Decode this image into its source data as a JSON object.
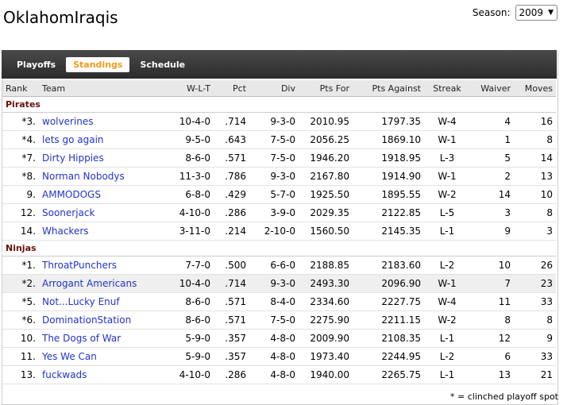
{
  "page_title": "OklahomIraqis",
  "season": {
    "label": "Season:",
    "value": "2009"
  },
  "tabs": [
    {
      "label": "Playoffs",
      "active": false
    },
    {
      "label": "Standings",
      "active": true
    },
    {
      "label": "Schedule",
      "active": false
    }
  ],
  "columns": [
    "Rank",
    "Team",
    "W-L-T",
    "Pct",
    "Div",
    "Pts For",
    "Pts Against",
    "Streak",
    "Waiver",
    "Moves"
  ],
  "divisions": [
    {
      "name": "Pirates",
      "teams": [
        {
          "rank": "*3.",
          "team": "wolverines",
          "wlt": "10-4-0",
          "pct": ".714",
          "div": "9-3-0",
          "pts_for": "2010.95",
          "pts_against": "1797.35",
          "streak": "W-4",
          "waiver": "4",
          "moves": "16"
        },
        {
          "rank": "*4.",
          "team": "lets go again",
          "wlt": "9-5-0",
          "pct": ".643",
          "div": "7-5-0",
          "pts_for": "2056.25",
          "pts_against": "1869.10",
          "streak": "W-1",
          "waiver": "1",
          "moves": "8"
        },
        {
          "rank": "*7.",
          "team": "Dirty Hippies",
          "wlt": "8-6-0",
          "pct": ".571",
          "div": "7-5-0",
          "pts_for": "1946.20",
          "pts_against": "1918.95",
          "streak": "L-3",
          "waiver": "5",
          "moves": "14"
        },
        {
          "rank": "*8.",
          "team": "Norman Nobodys",
          "wlt": "11-3-0",
          "pct": ".786",
          "div": "9-3-0",
          "pts_for": "2167.80",
          "pts_against": "1914.90",
          "streak": "W-1",
          "waiver": "2",
          "moves": "13"
        },
        {
          "rank": "9.",
          "team": "AMMODOGS",
          "wlt": "6-8-0",
          "pct": ".429",
          "div": "5-7-0",
          "pts_for": "1925.50",
          "pts_against": "1895.55",
          "streak": "W-2",
          "waiver": "14",
          "moves": "10"
        },
        {
          "rank": "12.",
          "team": "Soonerjack",
          "wlt": "4-10-0",
          "pct": ".286",
          "div": "3-9-0",
          "pts_for": "2029.35",
          "pts_against": "2122.85",
          "streak": "L-5",
          "waiver": "3",
          "moves": "8"
        },
        {
          "rank": "14.",
          "team": "Whackers",
          "wlt": "3-11-0",
          "pct": ".214",
          "div": "2-10-0",
          "pts_for": "1560.50",
          "pts_against": "2145.35",
          "streak": "L-1",
          "waiver": "9",
          "moves": "3"
        }
      ]
    },
    {
      "name": "Ninjas",
      "teams": [
        {
          "rank": "*1.",
          "team": "ThroatPunchers",
          "wlt": "7-7-0",
          "pct": ".500",
          "div": "6-6-0",
          "pts_for": "2188.85",
          "pts_against": "2183.60",
          "streak": "L-2",
          "waiver": "10",
          "moves": "26"
        },
        {
          "rank": "*2.",
          "team": "Arrogant Americans",
          "wlt": "10-4-0",
          "pct": ".714",
          "div": "9-3-0",
          "pts_for": "2493.30",
          "pts_against": "2096.90",
          "streak": "W-1",
          "waiver": "7",
          "moves": "23",
          "highlight": true
        },
        {
          "rank": "*5.",
          "team": "Not...Lucky Enuf",
          "wlt": "8-6-0",
          "pct": ".571",
          "div": "8-4-0",
          "pts_for": "2334.60",
          "pts_against": "2227.75",
          "streak": "W-4",
          "waiver": "11",
          "moves": "33"
        },
        {
          "rank": "*6.",
          "team": "DominationStation",
          "wlt": "8-6-0",
          "pct": ".571",
          "div": "7-5-0",
          "pts_for": "2275.90",
          "pts_against": "2211.15",
          "streak": "W-2",
          "waiver": "8",
          "moves": "8"
        },
        {
          "rank": "10.",
          "team": "The Dogs of War",
          "wlt": "5-9-0",
          "pct": ".357",
          "div": "4-8-0",
          "pts_for": "2009.90",
          "pts_against": "2108.35",
          "streak": "L-1",
          "waiver": "12",
          "moves": "9"
        },
        {
          "rank": "11.",
          "team": "Yes We Can",
          "wlt": "5-9-0",
          "pct": ".357",
          "div": "4-8-0",
          "pts_for": "1973.40",
          "pts_against": "2244.95",
          "streak": "L-2",
          "waiver": "6",
          "moves": "33"
        },
        {
          "rank": "13.",
          "team": "fuckwads",
          "wlt": "4-10-0",
          "pct": ".286",
          "div": "4-8-0",
          "pts_for": "1940.00",
          "pts_against": "2265.75",
          "streak": "L-1",
          "waiver": "13",
          "moves": "21"
        }
      ]
    }
  ],
  "footnote": "* = clinched playoff spot"
}
